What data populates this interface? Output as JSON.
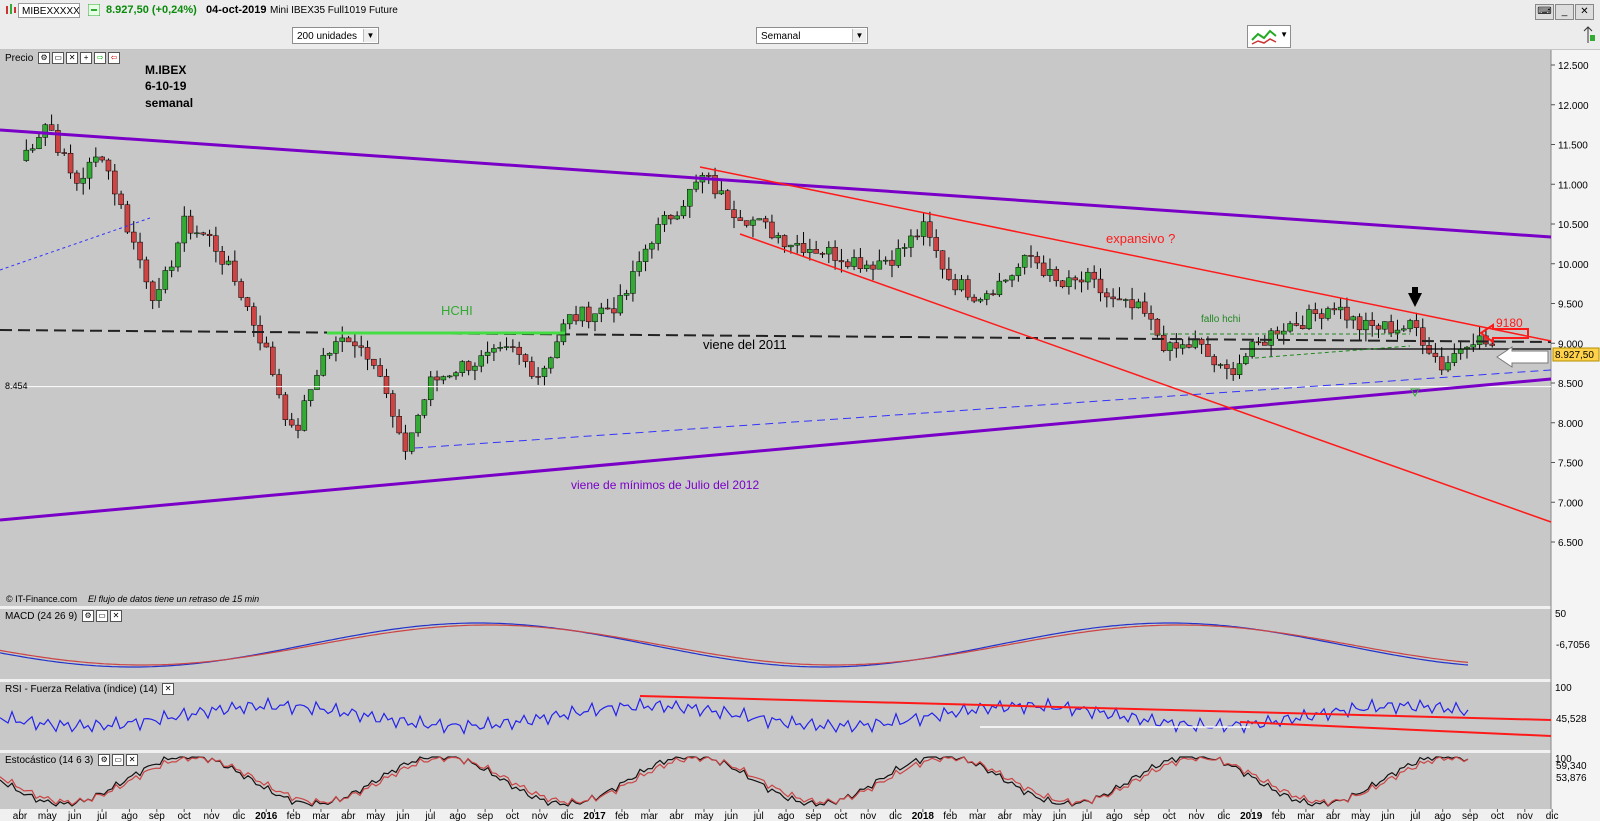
{
  "window": {
    "symbol": "MIBEXXXXX",
    "price_change": "8.927,50 (+0,24%)",
    "date": "04-oct-2019",
    "instrument": "Mini IBEX35 Full1019 Future"
  },
  "toolbar": {
    "units_select": "200 unidades",
    "period_select": "Semanal"
  },
  "panels": {
    "price": "Precio",
    "macd": "MACD (24 26 9)",
    "rsi": "RSI - Fuerza Relativa (índice) (14)",
    "stoch": "Estocástico (14 6 3)"
  },
  "annotations": {
    "title_line1": "M.IBEX",
    "title_line2": "6-10-19",
    "title_line3": "semanal",
    "hchi": "HCHI",
    "viene_2011": "viene del 2011",
    "viene_2012": "viene de mínimos de Julio del 2012",
    "expansivo": "expansivo ?",
    "fallo_hchi": "fallo hchi",
    "level_9180": "9180",
    "level_left": "8.454",
    "copyright": "© IT-Finance.com",
    "delay_note": "El flujo de datos tiene un retraso de 15 min"
  },
  "price_axis_ticks": [
    "12.500",
    "12.000",
    "11.500",
    "11.000",
    "10.500",
    "10.000",
    "9.500",
    "9.000",
    "8.500",
    "8.000",
    "7.500",
    "7.000",
    "6.500"
  ],
  "current_price_label": "8.927,50",
  "macd_axis": {
    "tick": "50",
    "value_label": "-6,7056"
  },
  "rsi_axis": {
    "tick": "100",
    "value_label": "45,528"
  },
  "stoch_axis": {
    "tick": "100",
    "value_label1": "59,340",
    "value_label2": "53,876"
  },
  "time_axis": [
    "abr",
    "may",
    "jun",
    "jul",
    "ago",
    "sep",
    "oct",
    "nov",
    "dic",
    "2016",
    "feb",
    "mar",
    "abr",
    "may",
    "jun",
    "jul",
    "ago",
    "sep",
    "oct",
    "nov",
    "dic",
    "2017",
    "feb",
    "mar",
    "abr",
    "may",
    "jun",
    "jul",
    "ago",
    "sep",
    "oct",
    "nov",
    "dic",
    "2018",
    "feb",
    "mar",
    "abr",
    "may",
    "jun",
    "jul",
    "ago",
    "sep",
    "oct",
    "nov",
    "dic",
    "2019",
    "feb",
    "mar",
    "abr",
    "may",
    "jun",
    "jul",
    "ago",
    "sep",
    "oct",
    "nov",
    "dic"
  ],
  "colors": {
    "purple_trend": "#7a00c8",
    "red_trend": "#ff1a1a",
    "blue_dash": "#3333ff",
    "green_hchi": "#44dd44",
    "bull_candle": "#33aa33",
    "bear_candle": "#cc4444",
    "chart_bg": "#c8c8c8",
    "price_label_bg": "#ffd24a"
  },
  "chart_data": {
    "type": "candlestick",
    "timeframe": "weekly",
    "ylim": [
      6000,
      12800
    ],
    "keypoints": [
      {
        "x": "2015-04",
        "y": 11300
      },
      {
        "x": "2015-05",
        "y": 11800
      },
      {
        "x": "2015-06",
        "y": 11000
      },
      {
        "x": "2015-07",
        "y": 11400
      },
      {
        "x": "2015-08",
        "y": 10400
      },
      {
        "x": "2015-09",
        "y": 9500
      },
      {
        "x": "2015-10",
        "y": 10500
      },
      {
        "x": "2015-11",
        "y": 10300
      },
      {
        "x": "2015-12",
        "y": 9700
      },
      {
        "x": "2016-01",
        "y": 8900
      },
      {
        "x": "2016-02",
        "y": 7800
      },
      {
        "x": "2016-03",
        "y": 8800
      },
      {
        "x": "2016-04",
        "y": 9100
      },
      {
        "x": "2016-05",
        "y": 8800
      },
      {
        "x": "2016-06",
        "y": 7600
      },
      {
        "x": "2016-07",
        "y": 8500
      },
      {
        "x": "2016-08",
        "y": 8700
      },
      {
        "x": "2016-09",
        "y": 8800
      },
      {
        "x": "2016-10",
        "y": 8900
      },
      {
        "x": "2016-11",
        "y": 8600
      },
      {
        "x": "2016-12",
        "y": 9300
      },
      {
        "x": "2017-01",
        "y": 9400
      },
      {
        "x": "2017-02",
        "y": 9500
      },
      {
        "x": "2017-03",
        "y": 10300
      },
      {
        "x": "2017-04",
        "y": 10700
      },
      {
        "x": "2017-05",
        "y": 11100
      },
      {
        "x": "2017-06",
        "y": 10700
      },
      {
        "x": "2017-07",
        "y": 10500
      },
      {
        "x": "2017-08",
        "y": 10300
      },
      {
        "x": "2017-09",
        "y": 10200
      },
      {
        "x": "2017-10",
        "y": 10100
      },
      {
        "x": "2017-11",
        "y": 10000
      },
      {
        "x": "2017-12",
        "y": 10100
      },
      {
        "x": "2018-01",
        "y": 10450
      },
      {
        "x": "2018-02",
        "y": 9800
      },
      {
        "x": "2018-03",
        "y": 9600
      },
      {
        "x": "2018-04",
        "y": 9800
      },
      {
        "x": "2018-05",
        "y": 10100
      },
      {
        "x": "2018-06",
        "y": 9700
      },
      {
        "x": "2018-07",
        "y": 9800
      },
      {
        "x": "2018-08",
        "y": 9500
      },
      {
        "x": "2018-09",
        "y": 9400
      },
      {
        "x": "2018-10",
        "y": 8900
      },
      {
        "x": "2018-11",
        "y": 9000
      },
      {
        "x": "2018-12",
        "y": 8600
      },
      {
        "x": "2019-01",
        "y": 8900
      },
      {
        "x": "2019-02",
        "y": 9200
      },
      {
        "x": "2019-03",
        "y": 9300
      },
      {
        "x": "2019-04",
        "y": 9500
      },
      {
        "x": "2019-05",
        "y": 9200
      },
      {
        "x": "2019-06",
        "y": 9200
      },
      {
        "x": "2019-07",
        "y": 9200
      },
      {
        "x": "2019-08",
        "y": 8700
      },
      {
        "x": "2019-09",
        "y": 9100
      },
      {
        "x": "2019-10",
        "y": 8927.5
      }
    ],
    "horizontal_levels": [
      9180,
      8927.5,
      8454
    ]
  }
}
